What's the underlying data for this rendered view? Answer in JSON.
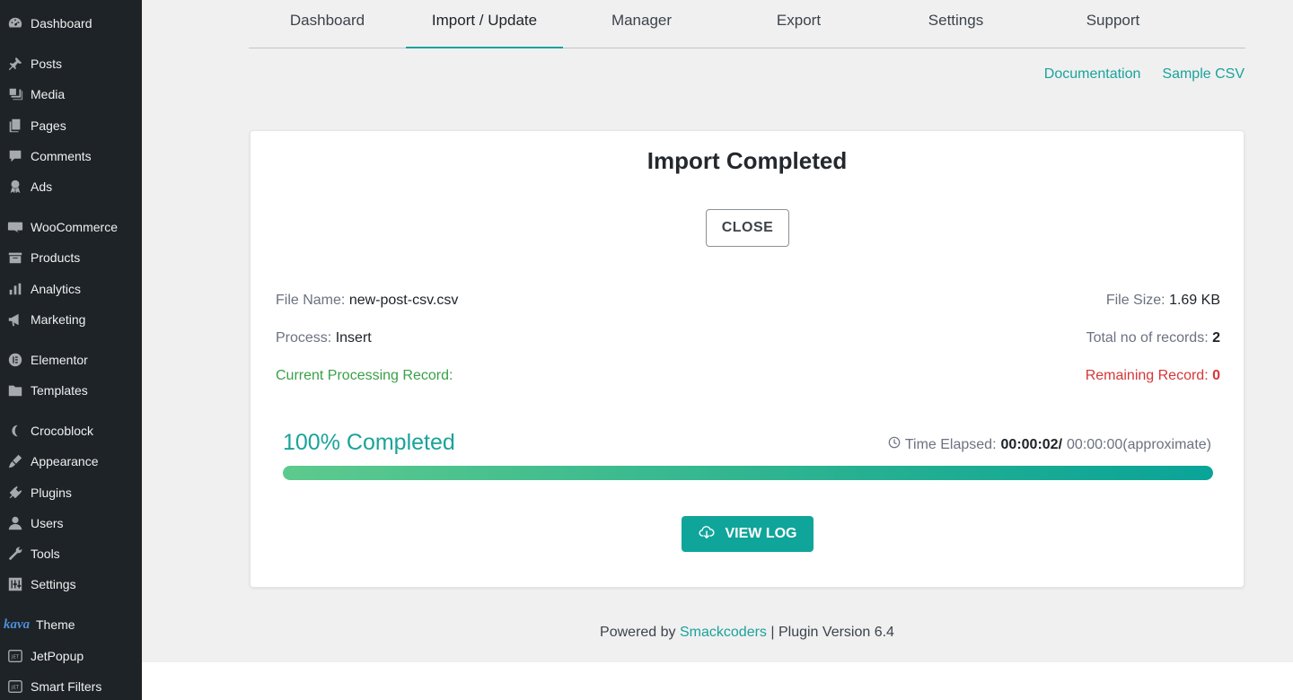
{
  "sidebar": {
    "items": [
      {
        "label": "Dashboard",
        "icon": "dashboard-icon"
      },
      {
        "label": "Posts",
        "icon": "pin-icon"
      },
      {
        "label": "Media",
        "icon": "media-icon"
      },
      {
        "label": "Pages",
        "icon": "pages-icon"
      },
      {
        "label": "Comments",
        "icon": "comments-icon"
      },
      {
        "label": "Ads",
        "icon": "award-icon"
      },
      {
        "label": "WooCommerce",
        "icon": "woo-icon"
      },
      {
        "label": "Products",
        "icon": "archive-icon"
      },
      {
        "label": "Analytics",
        "icon": "bar-chart-icon"
      },
      {
        "label": "Marketing",
        "icon": "megaphone-icon"
      },
      {
        "label": "Elementor",
        "icon": "elementor-icon"
      },
      {
        "label": "Templates",
        "icon": "folder-icon"
      },
      {
        "label": "Crocoblock",
        "icon": "crocoblock-icon"
      },
      {
        "label": "Appearance",
        "icon": "brush-icon"
      },
      {
        "label": "Plugins",
        "icon": "plug-icon"
      },
      {
        "label": "Users",
        "icon": "user-icon"
      },
      {
        "label": "Tools",
        "icon": "wrench-icon"
      },
      {
        "label": "Settings",
        "icon": "sliders-icon"
      },
      {
        "label": "Theme",
        "icon": "kava-logo",
        "logo_text": "kava"
      },
      {
        "label": "JetPopup",
        "icon": "jet-icon"
      },
      {
        "label": "Smart Filters",
        "icon": "jet-icon"
      }
    ]
  },
  "tabs": [
    "Dashboard",
    "Import / Update",
    "Manager",
    "Export",
    "Settings",
    "Support"
  ],
  "active_tab": "Import / Update",
  "links": {
    "documentation": "Documentation",
    "sample_csv": "Sample CSV"
  },
  "card": {
    "title": "Import Completed",
    "close_label": "CLOSE",
    "file_name_label": "File Name:",
    "file_name": "new-post-csv.csv",
    "file_size_label": "File Size:",
    "file_size": "1.69 KB",
    "process_label": "Process:",
    "process": "Insert",
    "total_label": "Total no of records:",
    "total": "2",
    "current_label": "Current Processing Record:",
    "current": "",
    "remaining_label": "Remaining Record:",
    "remaining": "0",
    "progress_text": "100% Completed",
    "progress_fraction": 1.0,
    "elapsed_label": "Time Elapsed:",
    "elapsed_value": "00:00:02/",
    "elapsed_approx": "00:00:00(approximate)",
    "view_log_label": "VIEW LOG"
  },
  "footer": {
    "prefix": "Powered by",
    "brand": "Smackcoders",
    "suffix": "| Plugin Version 6.4"
  },
  "colors": {
    "accent": "#1aa39a",
    "sidebar_bg": "#1d2327",
    "success": "#3aa04a",
    "danger": "#d63638"
  }
}
